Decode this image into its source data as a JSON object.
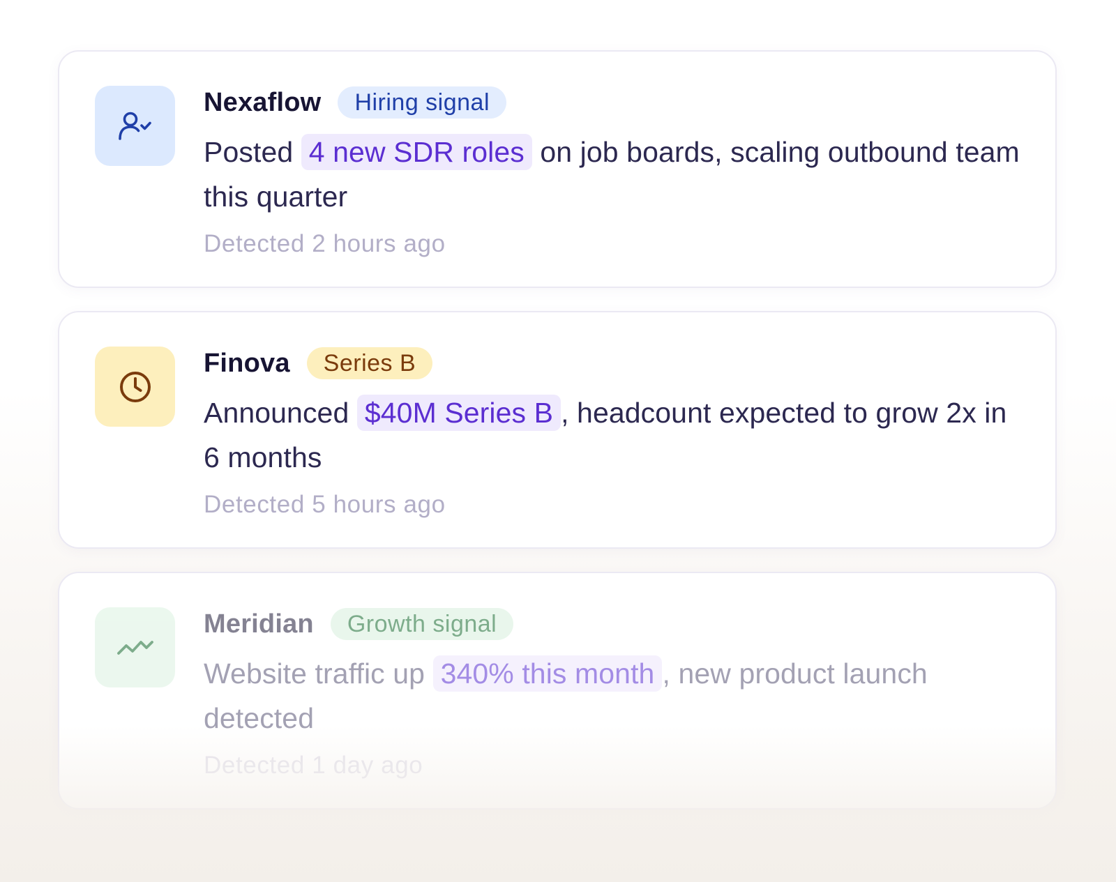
{
  "signals": [
    {
      "company": "Nexaflow",
      "badge": "Hiring signal",
      "icon": "user-check-icon",
      "text_before": "Posted",
      "highlight": "4 new SDR roles",
      "text_after": "on job boards, scaling outbound team this quarter",
      "detected": "Detected 2 hours ago"
    },
    {
      "company": "Finova",
      "badge": "Series B",
      "icon": "clock-icon",
      "text_before": "Announced",
      "highlight": "$40M Series B",
      "text_after": ", headcount expected to grow 2x in 6 months",
      "detected": "Detected 5 hours ago"
    },
    {
      "company": "Meridian",
      "badge": "Growth signal",
      "icon": "trend-line-icon",
      "text_before": "Website traffic up",
      "highlight": "340% this month",
      "text_after": ", new product launch detected",
      "detected": "Detected 1 day ago"
    }
  ],
  "colors": {
    "highlight_bg": "#efeafd",
    "highlight_text": "#5b2ed1",
    "hiring_badge_bg": "#e3edfe",
    "hiring_badge_text": "#1f3fa8",
    "series_badge_bg": "#fdefbd",
    "series_badge_text": "#7a3b0c",
    "growth_badge_bg": "#dcf2e1",
    "growth_badge_text": "#2f7a45"
  }
}
